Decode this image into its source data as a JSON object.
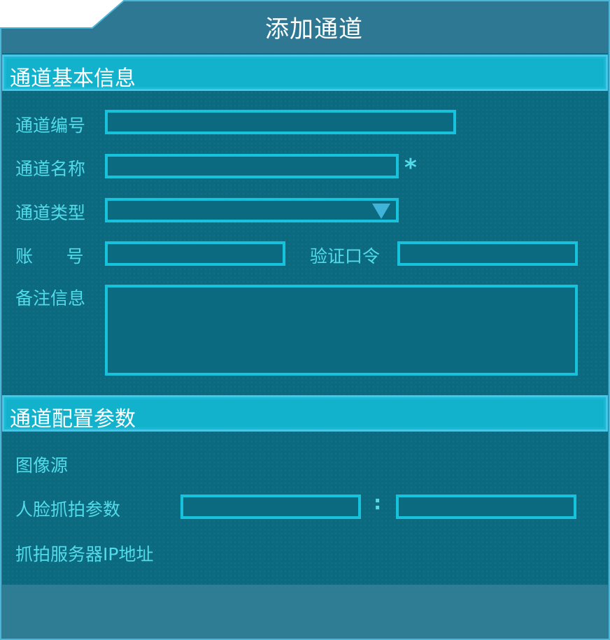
{
  "dialog": {
    "title": "添加通道"
  },
  "sections": {
    "basic": "通道基本信息",
    "config": "通道配置参数"
  },
  "fields": {
    "channel_number": {
      "label": "通道编号",
      "value": ""
    },
    "channel_name": {
      "label": "通道名称",
      "value": "",
      "required_mark": "*"
    },
    "channel_type": {
      "label": "通道类型",
      "value": ""
    },
    "account": {
      "label": "账      号",
      "value": ""
    },
    "verify_password": {
      "label": "验证口令",
      "value": ""
    },
    "remarks": {
      "label": "备注信息",
      "value": ""
    },
    "image_source": {
      "label": "图像源"
    },
    "face_capture": {
      "label": "人脸抓拍参数",
      "value_a": "",
      "separator": ":",
      "value_b": ""
    },
    "capture_server": {
      "label": "抓拍服务器IP地址"
    }
  },
  "colors": {
    "panel": "#0c6a80",
    "frame": "#2e7893",
    "section_header": "#12b2cd",
    "field_border": "#17c2dc",
    "label": "#52dbe9"
  },
  "icons": {
    "channel_type_dropdown": "triangle-down-icon"
  }
}
